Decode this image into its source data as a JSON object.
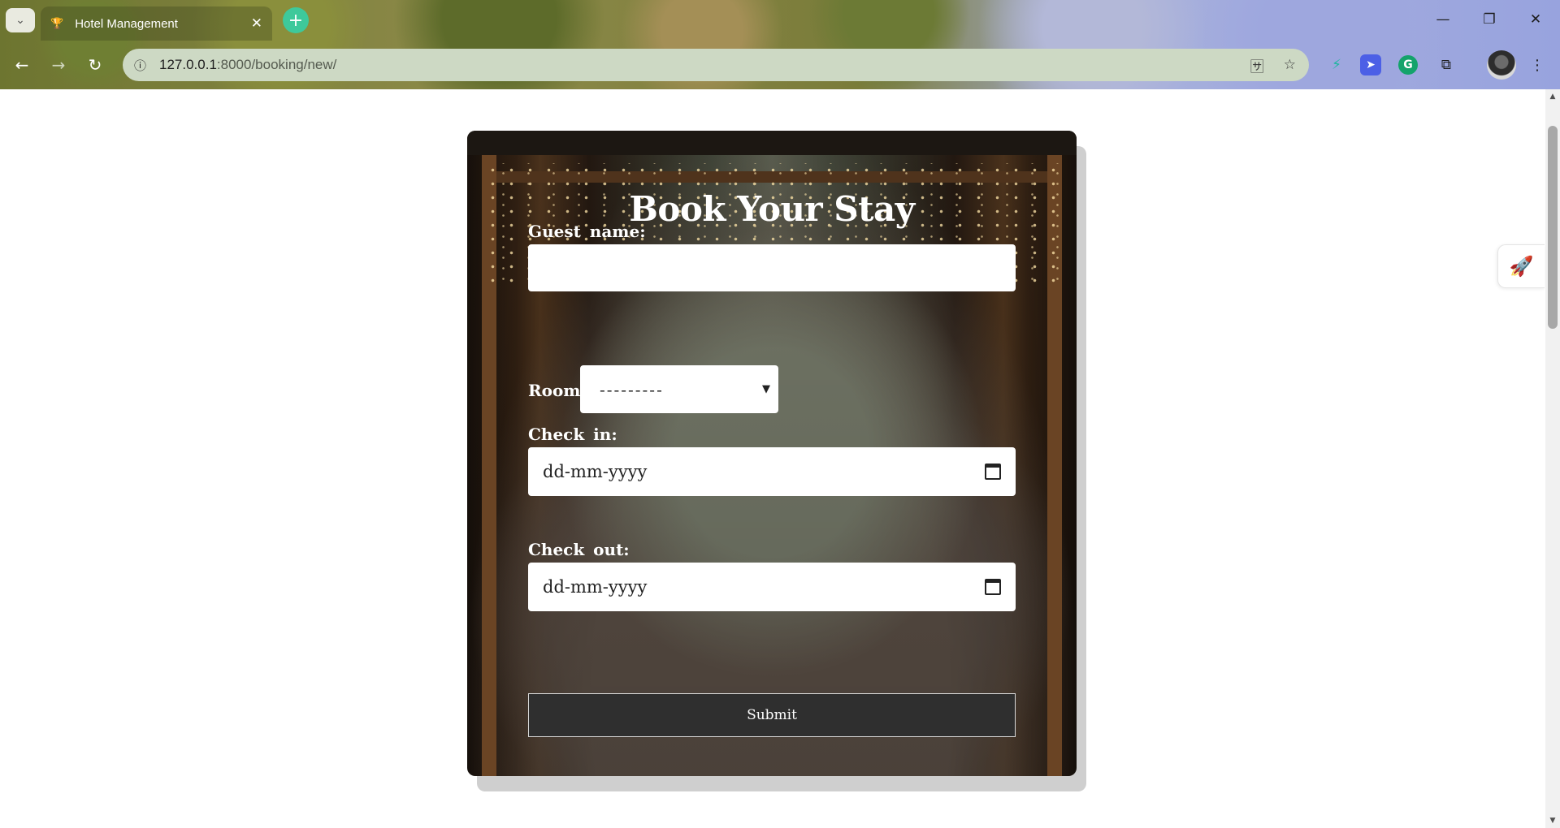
{
  "browser": {
    "tab_menu_icon": "chevron-down-icon",
    "tab": {
      "favicon": "🏆",
      "title": "Hotel Management",
      "close": "✕"
    },
    "new_tab": "+",
    "window_controls": {
      "minimize": "—",
      "restore": "❐",
      "close": "✕"
    },
    "nav": {
      "back": "←",
      "forward": "→",
      "reload": "↻"
    },
    "address": {
      "site_info": "ⓘ",
      "host": "127.0.0.1",
      "path": ":8000/booking/new/"
    },
    "omnibox_icons": {
      "translate": "🈂",
      "bookmark": "☆"
    },
    "extensions": [
      {
        "name": "extension-1",
        "glyph": "⚡",
        "color": "#1fb6a0"
      },
      {
        "name": "extension-2",
        "glyph": "➤",
        "color": "#ffffff",
        "bg": "#4c5fe6"
      },
      {
        "name": "grammarly",
        "glyph": "G",
        "color": "#ffffff",
        "bg": "#14a36b"
      },
      {
        "name": "extensions-puzzle",
        "glyph": "⧉",
        "color": "#1c1c1c"
      }
    ],
    "menu": "⋮"
  },
  "form": {
    "title": "Book Your Stay",
    "guest_name_label": "Guest name:",
    "guest_name_value": "",
    "room_label": "Room:",
    "room_selected": "---------",
    "check_in_label": "Check in:",
    "check_in_placeholder": "dd-mm-yyyy",
    "check_out_label": "Check out:",
    "check_out_placeholder": "dd-mm-yyyy",
    "submit_label": "Submit"
  },
  "scrollbar": {
    "up": "▲",
    "down": "▼"
  },
  "side_widget_icon": "rocket-icon"
}
